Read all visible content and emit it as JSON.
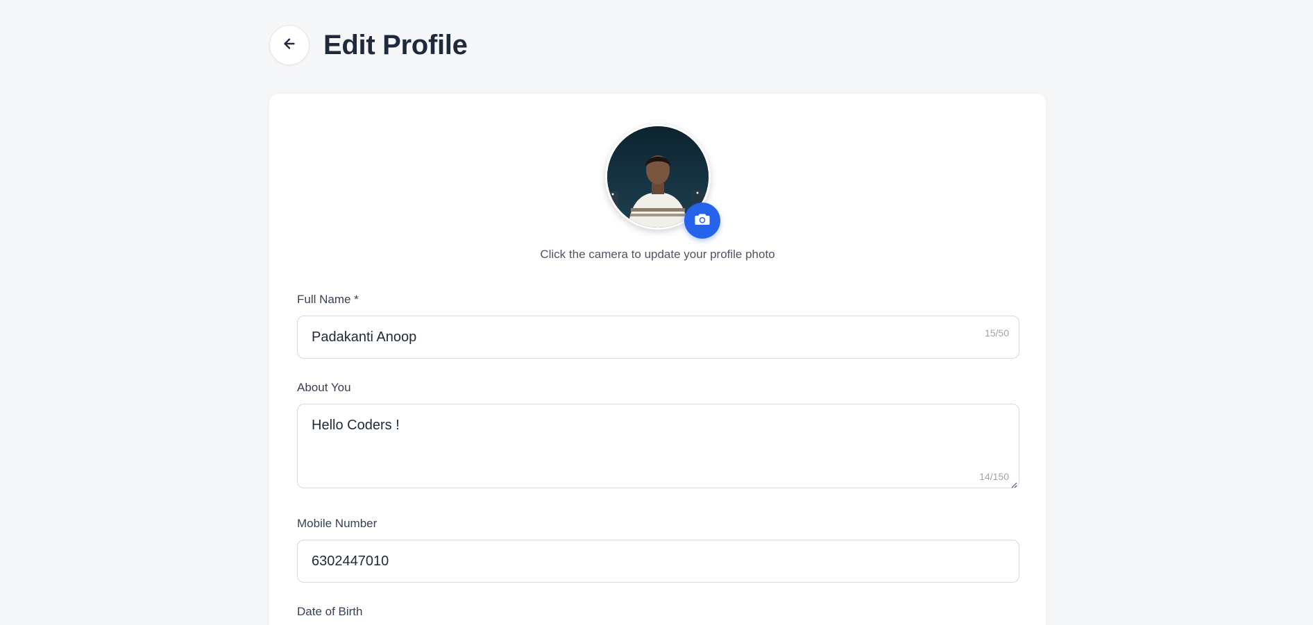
{
  "header": {
    "title": "Edit Profile",
    "back_icon": "arrow-left-icon"
  },
  "profile_photo": {
    "hint": "Click the camera to update your profile photo",
    "camera_icon": "camera-icon",
    "accent_color": "#2563eb"
  },
  "form": {
    "full_name": {
      "label": "Full Name *",
      "value": "Padakanti Anoop",
      "counter": "15/50"
    },
    "about": {
      "label": "About You",
      "value": "Hello Coders !",
      "counter": "14/150"
    },
    "mobile": {
      "label": "Mobile Number",
      "value": "6302447010"
    },
    "dob": {
      "label": "Date of Birth"
    }
  }
}
